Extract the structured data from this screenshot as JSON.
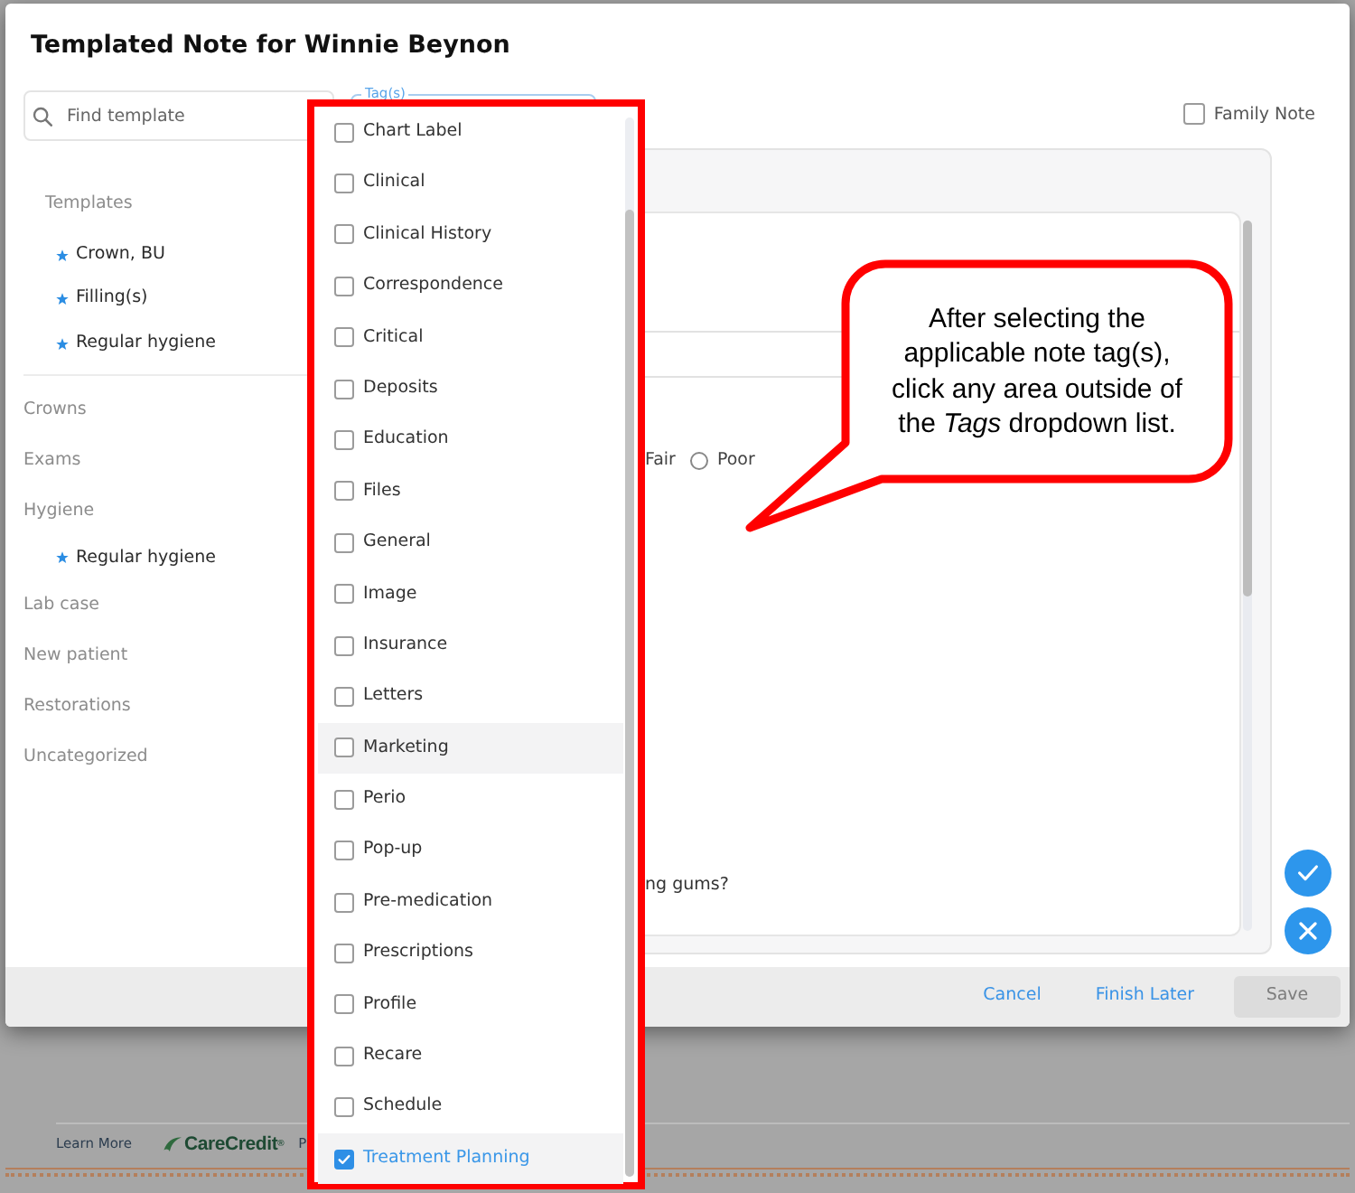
{
  "dialog": {
    "title": "Templated Note for Winnie Beynon"
  },
  "sidebar": {
    "search": {
      "placeholder": "Find template"
    },
    "favorites": {
      "heading": "Templates",
      "items": [
        {
          "label": "Crown, BU"
        },
        {
          "label": "Filling(s)"
        },
        {
          "label": "Regular hygiene"
        }
      ]
    },
    "categories": [
      {
        "label": "Crowns"
      },
      {
        "label": "Exams"
      },
      {
        "label": "Hygiene",
        "children": [
          {
            "label": "Regular hygiene"
          }
        ]
      },
      {
        "label": "Lab case"
      },
      {
        "label": "New patient"
      },
      {
        "label": "Restorations"
      },
      {
        "label": "Uncategorized"
      }
    ]
  },
  "tags_field": {
    "label": "Tag(s)"
  },
  "family_note": {
    "label": "Family Note",
    "checked": false
  },
  "note_form": {
    "rating_fragment": "Fair",
    "rating_option": {
      "label": "Poor",
      "selected": false
    },
    "question_fragment": "ng gums?"
  },
  "footer": {
    "buttons": [
      {
        "kind": "link",
        "label": "Cancel",
        "disabled": false
      },
      {
        "kind": "link",
        "label": "Finish Later",
        "disabled": false
      },
      {
        "kind": "solid",
        "label": "Save",
        "disabled": true
      }
    ]
  },
  "background_page": {
    "link": "Learn More",
    "logo_text": "CareCredit$^{®}$",
    "cut_text": "P"
  },
  "tag_dropdown": {
    "items": [
      {
        "label": "Chart Label",
        "checked": false,
        "highlighted": false
      },
      {
        "label": "Clinical",
        "checked": false,
        "highlighted": false
      },
      {
        "label": "Clinical History",
        "checked": false,
        "highlighted": false
      },
      {
        "label": "Correspondence",
        "checked": false,
        "highlighted": false
      },
      {
        "label": "Critical",
        "checked": false,
        "highlighted": false
      },
      {
        "label": "Deposits",
        "checked": false,
        "highlighted": false
      },
      {
        "label": "Education",
        "checked": false,
        "highlighted": false
      },
      {
        "label": "Files",
        "checked": false,
        "highlighted": false
      },
      {
        "label": "General",
        "checked": false,
        "highlighted": false
      },
      {
        "label": "Image",
        "checked": false,
        "highlighted": false
      },
      {
        "label": "Insurance",
        "checked": false,
        "highlighted": false
      },
      {
        "label": "Letters",
        "checked": false,
        "highlighted": false
      },
      {
        "label": "Marketing",
        "checked": false,
        "highlighted": true
      },
      {
        "label": "Perio",
        "checked": false,
        "highlighted": false
      },
      {
        "label": "Pop-up",
        "checked": false,
        "highlighted": false
      },
      {
        "label": "Pre-medication",
        "checked": false,
        "highlighted": false
      },
      {
        "label": "Prescriptions",
        "checked": false,
        "highlighted": false
      },
      {
        "label": "Profile",
        "checked": false,
        "highlighted": false
      },
      {
        "label": "Recare",
        "checked": false,
        "highlighted": false
      },
      {
        "label": "Schedule",
        "checked": false,
        "highlighted": false
      },
      {
        "label": "Treatment Planning",
        "checked": true,
        "highlighted": true
      }
    ]
  },
  "callout": {
    "text": "After selecting the applicable note tag(s), click any area outside of the *Tags* dropdown list."
  }
}
